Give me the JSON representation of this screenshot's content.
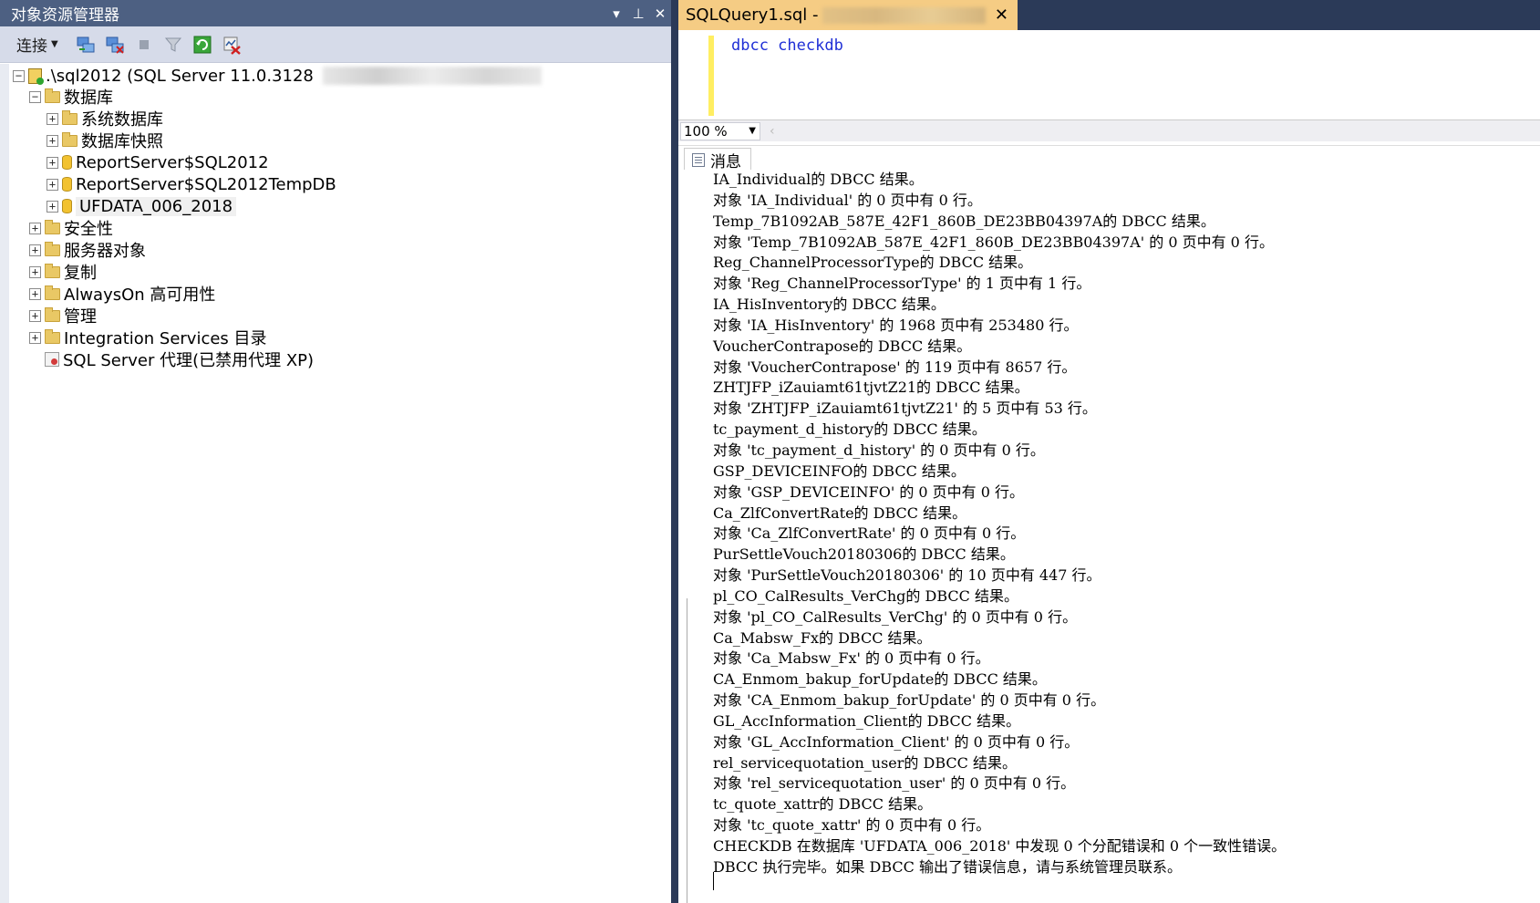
{
  "object_explorer": {
    "title": "对象资源管理器",
    "controls": {
      "dropdown": "▾",
      "pin": "⊥",
      "close": "✕"
    },
    "toolbar": {
      "connect_label": "连接"
    },
    "tree": {
      "server": ".\\sql2012 (SQL Server 11.0.3128",
      "databases": "数据库",
      "system_db": "系统数据库",
      "db_snapshots": "数据库快照",
      "db1": "ReportServer$SQL2012",
      "db2": "ReportServer$SQL2012TempDB",
      "db3": "UFDATA_006_2018",
      "security": "安全性",
      "server_objects": "服务器对象",
      "replication": "复制",
      "alwayson": "AlwaysOn 高可用性",
      "management": "管理",
      "integration": "Integration Services 目录",
      "agent": "SQL Server 代理(已禁用代理 XP)"
    }
  },
  "query_window": {
    "tab_title": "SQLQuery1.sql -",
    "tab_close": "✕",
    "code": "dbcc checkdb",
    "zoom": "100 %",
    "results_tab": "消息",
    "messages": [
      "IA_Individual的 DBCC 结果。",
      "对象 'IA_Individual' 的 0 页中有 0 行。",
      "Temp_7B1092AB_587E_42F1_860B_DE23BB04397A的 DBCC 结果。",
      "对象 'Temp_7B1092AB_587E_42F1_860B_DE23BB04397A' 的 0 页中有 0 行。",
      "Reg_ChannelProcessorType的 DBCC 结果。",
      "对象 'Reg_ChannelProcessorType' 的 1 页中有 1 行。",
      "IA_HisInventory的 DBCC 结果。",
      "对象 'IA_HisInventory' 的 1968 页中有 253480 行。",
      "VoucherContrapose的 DBCC 结果。",
      "对象 'VoucherContrapose' 的 119 页中有 8657 行。",
      "ZHTJFP_iZauiamt61tjvtZ21的 DBCC 结果。",
      "对象 'ZHTJFP_iZauiamt61tjvtZ21' 的 5 页中有 53 行。",
      "tc_payment_d_history的 DBCC 结果。",
      "对象 'tc_payment_d_history' 的 0 页中有 0 行。",
      "GSP_DEVICEINFO的 DBCC 结果。",
      "对象 'GSP_DEVICEINFO' 的 0 页中有 0 行。",
      "Ca_ZlfConvertRate的 DBCC 结果。",
      "对象 'Ca_ZlfConvertRate' 的 0 页中有 0 行。",
      "PurSettleVouch20180306的 DBCC 结果。",
      "对象 'PurSettleVouch20180306' 的 10 页中有 447 行。",
      "pl_CO_CalResults_VerChg的 DBCC 结果。",
      "对象 'pl_CO_CalResults_VerChg' 的 0 页中有 0 行。",
      "Ca_Mabsw_Fx的 DBCC 结果。",
      "对象 'Ca_Mabsw_Fx' 的 0 页中有 0 行。",
      "CA_Enmom_bakup_forUpdate的 DBCC 结果。",
      "对象 'CA_Enmom_bakup_forUpdate' 的 0 页中有 0 行。",
      "GL_AccInformation_Client的 DBCC 结果。",
      "对象 'GL_AccInformation_Client' 的 0 页中有 0 行。",
      "rel_servicequotation_user的 DBCC 结果。",
      "对象 'rel_servicequotation_user' 的 0 页中有 0 行。",
      "tc_quote_xattr的 DBCC 结果。",
      "对象 'tc_quote_xattr' 的 0 页中有 0 行。",
      "CHECKDB 在数据库 'UFDATA_006_2018' 中发现 0 个分配错误和 0 个一致性错误。",
      "DBCC 执行完毕。如果 DBCC 输出了错误信息，请与系统管理员联系。"
    ]
  },
  "colors": {
    "titlebar": "#4d6082",
    "frame": "#2b3a58",
    "active_tab": "#f5cc84",
    "keyword": "#1f2fd6"
  }
}
